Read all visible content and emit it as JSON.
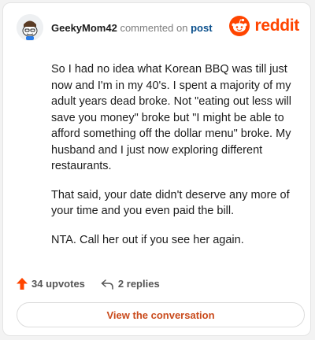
{
  "header": {
    "username": "GeekyMom42",
    "action_text": "commented on",
    "target_text": "post",
    "avatar_icon": "user-avatar-icon"
  },
  "brand": {
    "logo_icon": "reddit-alien-icon",
    "wordmark": "reddit",
    "color": "#ff4500"
  },
  "comment": {
    "paragraphs": [
      "So I had no idea what Korean BBQ was till just now and I'm in my 40's. I spent a majority of my adult years dead broke. Not \"eating out less will save you money\" broke but \"I might be able to afford something off the dollar menu\" broke. My husband and I just now exploring different restaurants.",
      "That said, your date didn't deserve any more of your time and you even paid the bill.",
      "NTA. Call her out if you see her again."
    ]
  },
  "stats": {
    "upvotes_label": "34 upvotes",
    "replies_label": "2 replies",
    "upvote_color": "#ff4500"
  },
  "cta": {
    "label": "View the conversation"
  }
}
